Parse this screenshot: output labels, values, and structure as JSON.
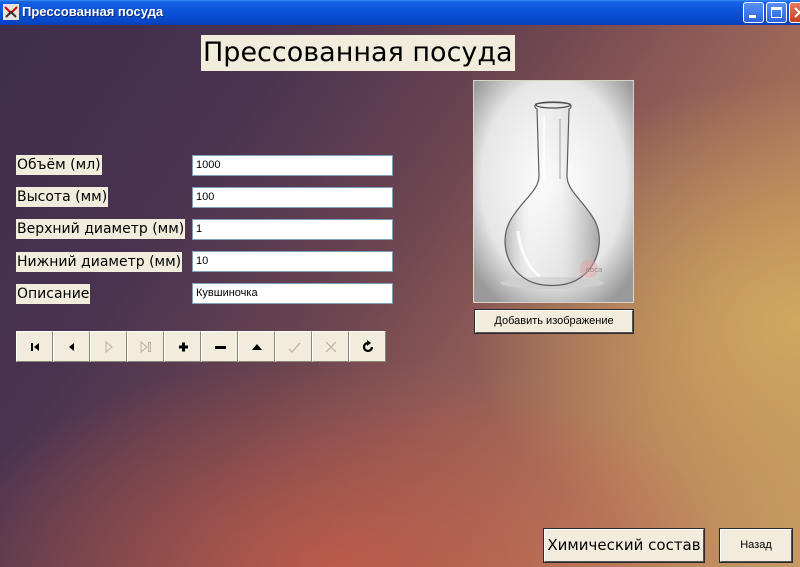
{
  "window": {
    "title": "Прессованная посуда",
    "titlebar_color": "#0a52d8"
  },
  "heading": "Прессованная посуда",
  "fields": [
    {
      "label": "Объём (мл)",
      "value": "1000"
    },
    {
      "label": "Высота (мм)",
      "value": "100"
    },
    {
      "label": "Верхний диаметр (мм)",
      "value": "1"
    },
    {
      "label": "Нижний диаметр (мм)",
      "value": "10"
    },
    {
      "label": "Описание",
      "value": "Кувшиночка"
    }
  ],
  "navigator": {
    "buttons": [
      {
        "icon": "first-record-icon",
        "enabled": true
      },
      {
        "icon": "prior-record-icon",
        "enabled": true
      },
      {
        "icon": "next-record-icon",
        "enabled": false
      },
      {
        "icon": "last-record-icon",
        "enabled": false
      },
      {
        "icon": "insert-record-icon",
        "enabled": true
      },
      {
        "icon": "delete-record-icon",
        "enabled": true
      },
      {
        "icon": "edit-record-icon",
        "enabled": true
      },
      {
        "icon": "post-record-icon",
        "enabled": false
      },
      {
        "icon": "cancel-edit-icon",
        "enabled": false
      },
      {
        "icon": "refresh-icon",
        "enabled": true
      }
    ]
  },
  "picture": {
    "watermark": "coca"
  },
  "buttons": {
    "add_image": "Добавить изображение",
    "chemical_composition": "Химический состав",
    "back": "Назад"
  }
}
